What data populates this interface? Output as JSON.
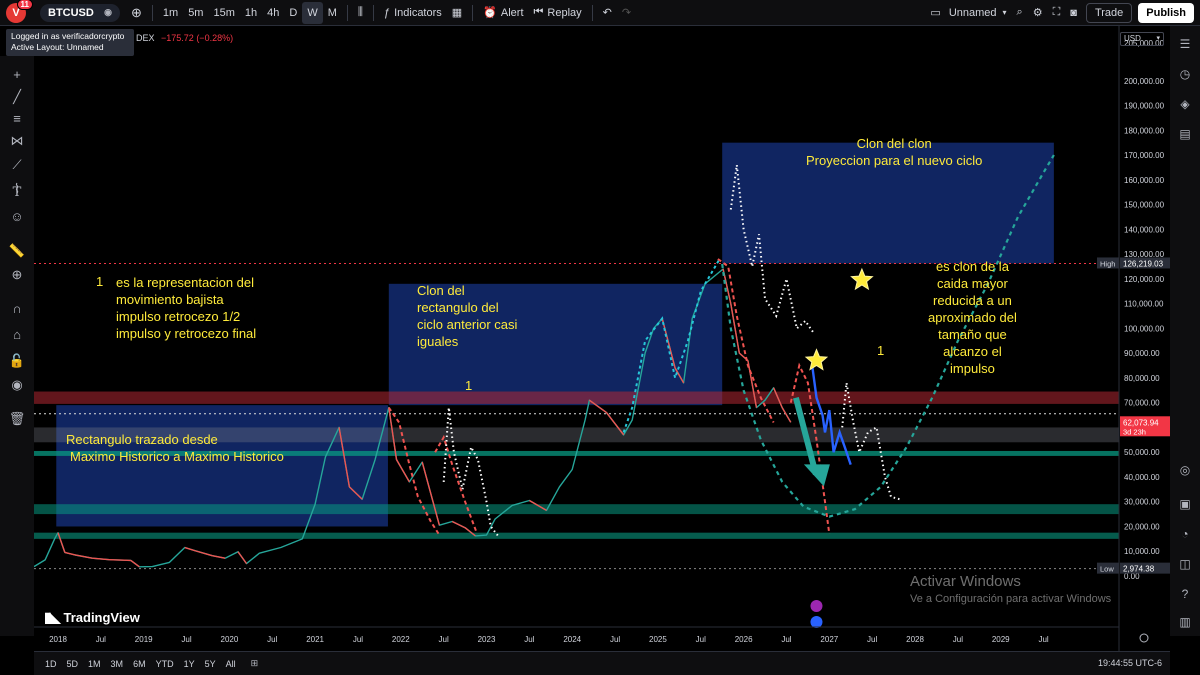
{
  "topbar": {
    "avatar_letter": "V",
    "notification_count": "11",
    "symbol": "BTCUSD",
    "intervals": [
      "1m",
      "5m",
      "15m",
      "1h",
      "4h",
      "D",
      "W",
      "M"
    ],
    "active_interval": "W",
    "indicators_label": "Indicators",
    "alert_label": "Alert",
    "replay_label": "Replay",
    "layout_name": "Unnamed",
    "trade_label": "Trade",
    "publish_label": "Publish"
  },
  "login_tooltip": {
    "line1": "Logged in as verificadorcrypto",
    "line2": "Active Layout: Unnamed"
  },
  "legend": {
    "exchange_fragment": "DEX",
    "change": "−175.72 (−0.28%)"
  },
  "currency_selector": "USD",
  "annotations": {
    "left_note_marker": "1",
    "left_note": [
      "es la representacion del",
      "movimiento bajista",
      "impulso retrocezo 1/2",
      "impulso y retrocezo final"
    ],
    "clone_rect_note": [
      "Clon del",
      "rectangulo del",
      "ciclo anterior casi",
      "iguales"
    ],
    "clone_rect_marker": "1",
    "base_rect_note": [
      "Rectangulo trazado desde",
      "Maximo Historico a Maximo Historico"
    ],
    "clone_of_clone_note": [
      "Clon del clon",
      "Proyeccion para el nuevo ciclo"
    ],
    "right_note": [
      "es clon de la",
      "caida mayor",
      "reducida a un",
      "aproximado del",
      "tamaño que",
      "alcanzo el",
      "impulso"
    ],
    "right_marker": "1"
  },
  "branding": {
    "logo_text": "TradingView",
    "watermark_line1": "Activar Windows",
    "watermark_line2": "Ve a Configuración para activar Windows"
  },
  "bottombar": {
    "ranges": [
      "1D",
      "5D",
      "1M",
      "3M",
      "6M",
      "YTD",
      "1Y",
      "5Y",
      "All"
    ],
    "clock": "19:44:55 UTC-6"
  },
  "chart_data": {
    "type": "line",
    "ylim": [
      0,
      210000
    ],
    "y_ticks": [
      0,
      10000,
      20000,
      30000,
      40000,
      50000,
      60000,
      70000,
      80000,
      90000,
      100000,
      110000,
      120000,
      130000,
      140000,
      150000,
      160000,
      170000,
      180000,
      190000,
      200000
    ],
    "y_tick_labels": [
      "0.00",
      "10,000.00",
      "20,000.00",
      "30,000.00",
      "40,000.00",
      "50,000.00",
      "60,000.00",
      "70,000.00",
      "80,000.00",
      "90,000.00",
      "100,000.00",
      "110,000.00",
      "120,000.00",
      "130,000.00",
      "140,000.00",
      "150,000.00",
      "160,000.00",
      "170,000.00",
      "180,000.00",
      "190,000.00",
      "200,000.00",
      "205,000.00"
    ],
    "x_range": [
      2017.72,
      2030.38
    ],
    "x_ticks": [
      {
        "t": 2018.0,
        "label": "2018"
      },
      {
        "t": 2018.5,
        "label": "Jul"
      },
      {
        "t": 2019.0,
        "label": "2019"
      },
      {
        "t": 2019.5,
        "label": "Jul"
      },
      {
        "t": 2020.0,
        "label": "2020"
      },
      {
        "t": 2020.5,
        "label": "Jul"
      },
      {
        "t": 2021.0,
        "label": "2021"
      },
      {
        "t": 2021.5,
        "label": "Jul"
      },
      {
        "t": 2022.0,
        "label": "2022"
      },
      {
        "t": 2022.5,
        "label": "Jul"
      },
      {
        "t": 2023.0,
        "label": "2023"
      },
      {
        "t": 2023.5,
        "label": "Jul"
      },
      {
        "t": 2024.0,
        "label": "2024"
      },
      {
        "t": 2024.5,
        "label": "Jul"
      },
      {
        "t": 2025.0,
        "label": "2025"
      },
      {
        "t": 2025.5,
        "label": "Jul"
      },
      {
        "t": 2026.0,
        "label": "2026"
      },
      {
        "t": 2026.5,
        "label": "Jul"
      },
      {
        "t": 2027.0,
        "label": "2027"
      },
      {
        "t": 2027.5,
        "label": "Jul"
      },
      {
        "t": 2028.0,
        "label": "2028"
      },
      {
        "t": 2028.5,
        "label": "Jul"
      },
      {
        "t": 2029.0,
        "label": "2029"
      },
      {
        "t": 2029.5,
        "label": "Jul"
      }
    ],
    "price_labels": [
      {
        "name": "High",
        "value": 126219.03,
        "text": "126,219.03",
        "color": "#2a2e39"
      },
      {
        "name": "",
        "value": 62073.94,
        "text": "62,073.94",
        "sub": "3d 23h",
        "color": "#f23645"
      },
      {
        "name": "Low",
        "value": 2974.38,
        "text": "2,974.38",
        "color": "#2a2e39"
      }
    ],
    "series": [
      {
        "name": "BTCUSD",
        "color": "#26a69a",
        "points": [
          [
            2017.72,
            3800
          ],
          [
            2017.85,
            6500
          ],
          [
            2017.96,
            15000
          ],
          [
            2018.0,
            17500
          ],
          [
            2018.08,
            9500
          ],
          [
            2018.2,
            8500
          ],
          [
            2018.4,
            7200
          ],
          [
            2018.6,
            6600
          ],
          [
            2018.85,
            6300
          ],
          [
            2018.95,
            3700
          ],
          [
            2019.1,
            3800
          ],
          [
            2019.3,
            5500
          ],
          [
            2019.48,
            11500
          ],
          [
            2019.6,
            10200
          ],
          [
            2019.8,
            8200
          ],
          [
            2019.95,
            7200
          ],
          [
            2020.1,
            9800
          ],
          [
            2020.2,
            5000
          ],
          [
            2020.35,
            9200
          ],
          [
            2020.6,
            11500
          ],
          [
            2020.85,
            15000
          ],
          [
            2021.0,
            29000
          ],
          [
            2021.12,
            48000
          ],
          [
            2021.28,
            60000
          ],
          [
            2021.4,
            36000
          ],
          [
            2021.55,
            31000
          ],
          [
            2021.7,
            47000
          ],
          [
            2021.86,
            68000
          ],
          [
            2021.95,
            47000
          ],
          [
            2022.1,
            38000
          ],
          [
            2022.25,
            46000
          ],
          [
            2022.45,
            20500
          ],
          [
            2022.6,
            22000
          ],
          [
            2022.75,
            19500
          ],
          [
            2022.87,
            16200
          ],
          [
            2023.0,
            16500
          ],
          [
            2023.1,
            23000
          ],
          [
            2023.3,
            28500
          ],
          [
            2023.5,
            30500
          ],
          [
            2023.7,
            26500
          ],
          [
            2023.85,
            36000
          ],
          [
            2024.0,
            43000
          ],
          [
            2024.15,
            63000
          ],
          [
            2024.2,
            71000
          ],
          [
            2024.4,
            66000
          ],
          [
            2024.6,
            57000
          ],
          [
            2024.7,
            63000
          ],
          [
            2024.85,
            90000
          ],
          [
            2024.95,
            100000
          ],
          [
            2025.05,
            104000
          ],
          [
            2025.2,
            84000
          ],
          [
            2025.3,
            78000
          ],
          [
            2025.4,
            104000
          ],
          [
            2025.55,
            118000
          ],
          [
            2025.76,
            124000
          ],
          [
            2025.85,
            110000
          ],
          [
            2025.95,
            90000
          ],
          [
            2026.05,
            87000
          ],
          [
            2026.15,
            68000
          ],
          [
            2026.25,
            71000
          ],
          [
            2026.35,
            76000
          ],
          [
            2026.45,
            68000
          ],
          [
            2026.55,
            62074
          ]
        ]
      }
    ]
  }
}
